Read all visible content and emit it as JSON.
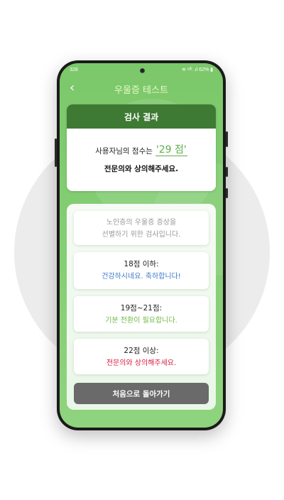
{
  "statusbar": {
    "time": "328",
    "indicators": "≋ ᵘᵗᴱ .ıl 62% ▮"
  },
  "header": {
    "back_icon": "‹",
    "title": "우울증 테스트"
  },
  "result": {
    "heading": "검사 결과",
    "score_prefix": "사용자님의 점수는",
    "score": "'29 점'",
    "advice": "전문의와 상의해주세요."
  },
  "info": {
    "intro_line1": "노인층의 우울증 증상을",
    "intro_line2": "선별하기 위한 검사입니다.",
    "ranges": [
      {
        "range": "18점 이하:",
        "message": "건강하시네요. 축하합니다!"
      },
      {
        "range": "19점~21점:",
        "message": "기분 전환이 필요합니다."
      },
      {
        "range": "22점 이상:",
        "message": "전문의와 상의해주세요."
      }
    ]
  },
  "restart_button": "처음으로 돌아가기",
  "colors": {
    "brand_green": "#3e7a34",
    "score_green": "#5fae4b",
    "good_blue": "#3f78c8",
    "mid_green": "#6fba45",
    "alert_red": "#d81b3d"
  }
}
